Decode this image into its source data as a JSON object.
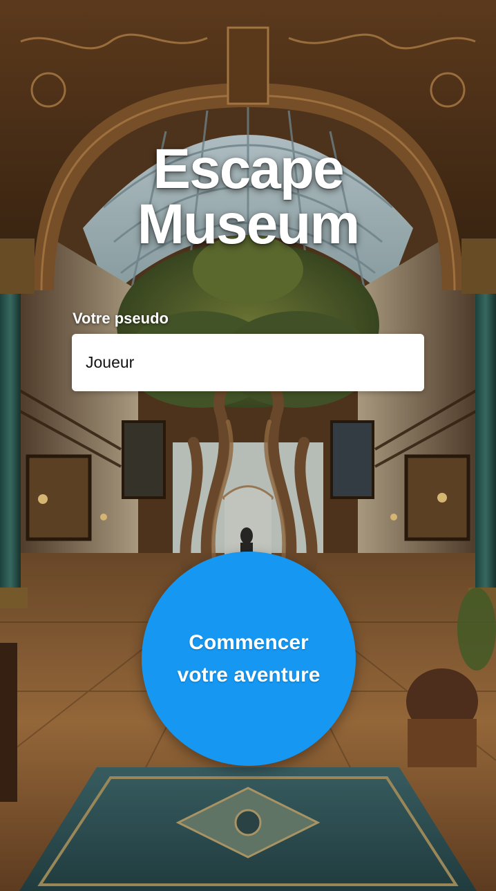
{
  "app": {
    "title_line1": "Escape",
    "title_line2": "Museum"
  },
  "form": {
    "pseudo_label": "Votre pseudo",
    "pseudo_value": "Joueur"
  },
  "start_button": {
    "label_line1": "Commencer",
    "label_line2": "votre aventure"
  },
  "colors": {
    "button": "#1597f2",
    "text_light": "#ffffff",
    "input_bg": "#ffffff"
  },
  "background": {
    "icon": "museum-hall-illustration"
  }
}
